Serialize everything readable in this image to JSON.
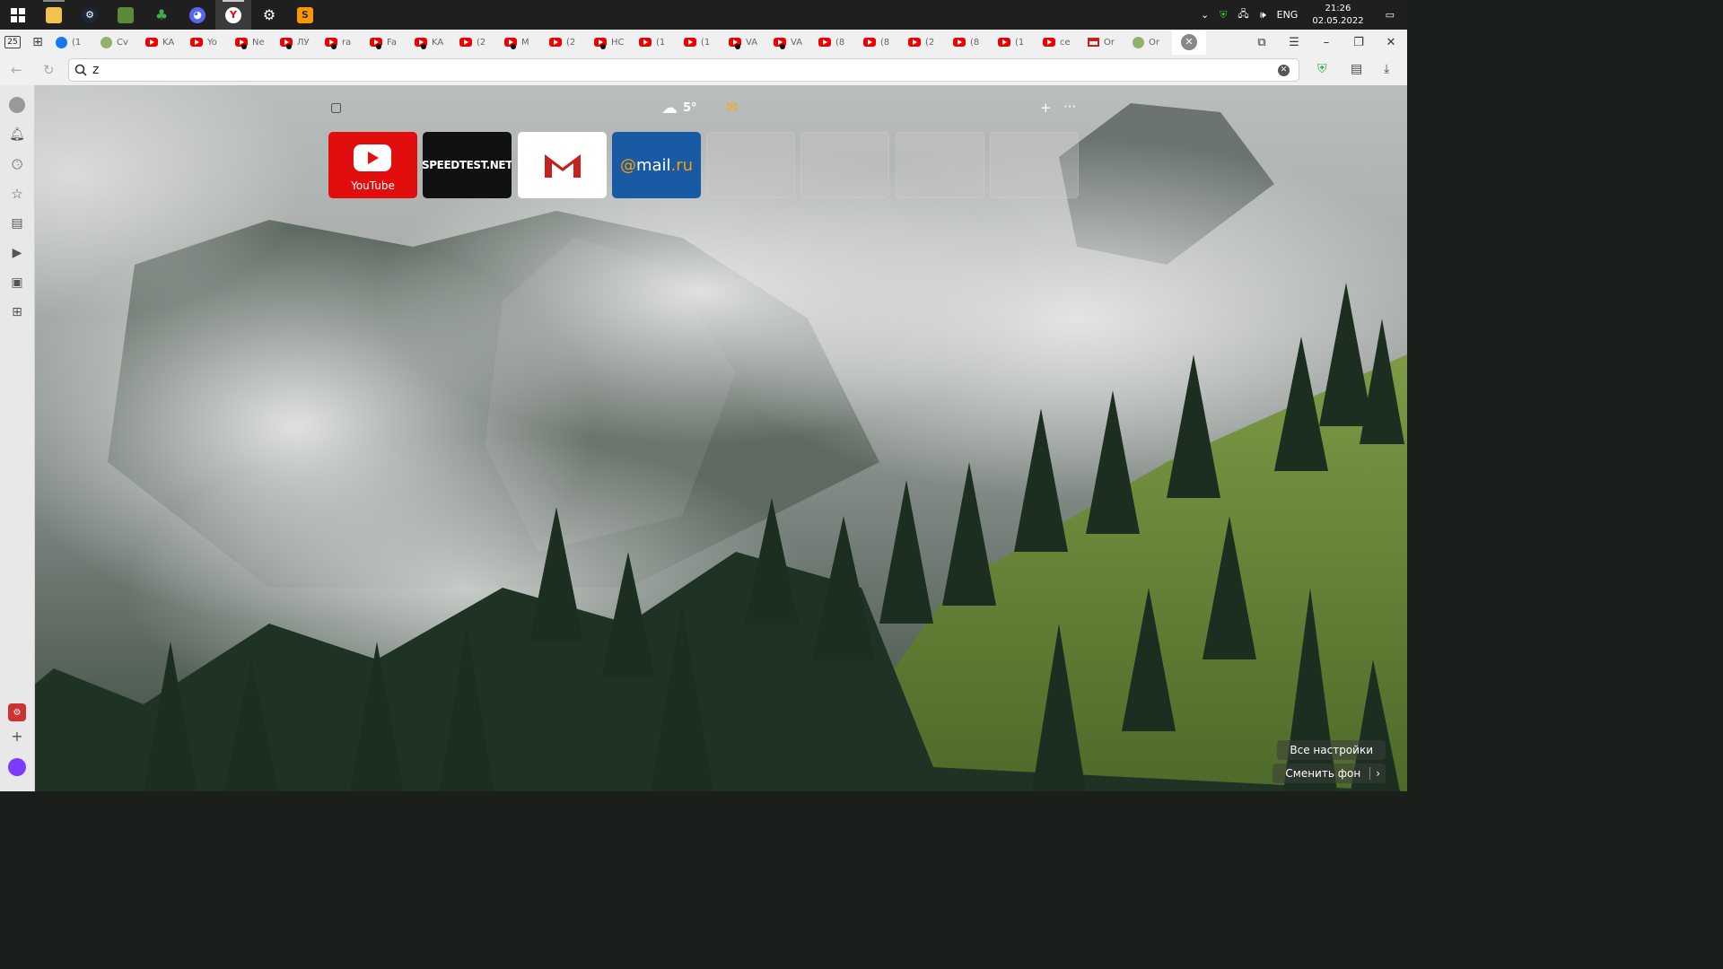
{
  "taskbar": {
    "apps": [
      {
        "name": "windows-start",
        "label": ""
      },
      {
        "name": "file-explorer",
        "label": ""
      },
      {
        "name": "steam",
        "label": ""
      },
      {
        "name": "minecraft",
        "label": ""
      },
      {
        "name": "tree-app",
        "label": ""
      },
      {
        "name": "discord",
        "label": ""
      },
      {
        "name": "yandex-browser",
        "label": ""
      },
      {
        "name": "settings",
        "label": ""
      },
      {
        "name": "sublime-text",
        "label": ""
      }
    ],
    "tray": {
      "language": "ENG",
      "time": "21:26",
      "date": "02.05.2022"
    }
  },
  "tabs": {
    "lead_count": "25",
    "items": [
      {
        "title": "(1",
        "icon": "facebook"
      },
      {
        "title": "Cv",
        "icon": "generic"
      },
      {
        "title": "KA",
        "icon": "youtube"
      },
      {
        "title": "Yo",
        "icon": "youtube"
      },
      {
        "title": "Ne",
        "icon": "youtube",
        "dot": true
      },
      {
        "title": "ЛУ",
        "icon": "youtube",
        "dot": true
      },
      {
        "title": "ra",
        "icon": "youtube",
        "dot": true
      },
      {
        "title": "Fa",
        "icon": "youtube",
        "dot": true
      },
      {
        "title": "KA",
        "icon": "youtube",
        "dot": true
      },
      {
        "title": "(2",
        "icon": "youtube"
      },
      {
        "title": "M",
        "icon": "youtube",
        "dot": true
      },
      {
        "title": "(2",
        "icon": "youtube"
      },
      {
        "title": "HC",
        "icon": "youtube",
        "dot": true
      },
      {
        "title": "(1",
        "icon": "youtube"
      },
      {
        "title": "(1",
        "icon": "youtube"
      },
      {
        "title": "VA",
        "icon": "youtube",
        "dot": true
      },
      {
        "title": "VA",
        "icon": "youtube",
        "dot": true
      },
      {
        "title": "(8",
        "icon": "youtube"
      },
      {
        "title": "(8",
        "icon": "youtube"
      },
      {
        "title": "(2",
        "icon": "youtube"
      },
      {
        "title": "(8",
        "icon": "youtube"
      },
      {
        "title": "(1",
        "icon": "youtube"
      },
      {
        "title": "ce",
        "icon": "youtube"
      },
      {
        "title": "Or",
        "icon": "gmail"
      },
      {
        "title": "Or",
        "icon": "generic"
      }
    ]
  },
  "addressbar": {
    "value": "z"
  },
  "newtab": {
    "weather_temp": "5°",
    "tiles": [
      {
        "type": "youtube",
        "label": "YouTube"
      },
      {
        "type": "speedtest",
        "label": "SPEEDTEST.NET"
      },
      {
        "type": "gmail",
        "label": ""
      },
      {
        "type": "mailru",
        "label_pre": "@",
        "label_main": "mail",
        "label_post": ".ru"
      },
      {
        "type": "empty"
      },
      {
        "type": "empty"
      },
      {
        "type": "empty"
      },
      {
        "type": "empty"
      }
    ],
    "all_settings": "Все настройки",
    "change_background": "Сменить фон"
  },
  "colors": {
    "youtube_red": "#e20e0e",
    "mailru_blue": "#1a5aa5",
    "mailru_orange": "#ff9e00"
  }
}
